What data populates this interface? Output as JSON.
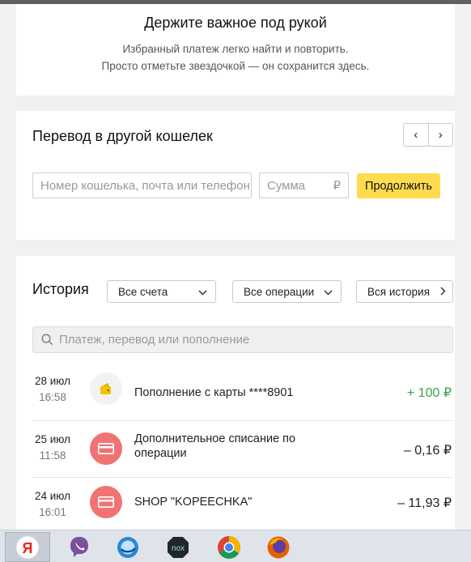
{
  "favorites": {
    "title": "Держите важное под рукой",
    "line1": "Избранный платеж легко найти и повторить.",
    "line2": "Просто отметьте звездочкой — он сохранится здесь."
  },
  "transfer": {
    "title": "Перевод в другой кошелек",
    "prev_label": "‹",
    "next_label": "›",
    "wallet_placeholder": "Номер кошелька, почта или телефон",
    "sum_placeholder": "Сумма",
    "currency": "₽",
    "continue_label": "Продолжить"
  },
  "history": {
    "title": "История",
    "accounts_filter": "Все счета",
    "operations_filter": "Все операции",
    "all_history_label": "Вся история",
    "search_placeholder": "Платеж, перевод или пополнение",
    "items": [
      {
        "date": "28 июл",
        "time": "16:58",
        "description": "Пополнение с карты ****8901",
        "amount": "+ 100 ₽",
        "icon": "wallet-icon"
      },
      {
        "date": "25 июл",
        "time": "11:58",
        "description": "Дополнительное списание по операции",
        "amount": "– 0,16 ₽",
        "icon": "card-icon"
      },
      {
        "date": "24 июл",
        "time": "16:01",
        "description": "SHOP \"KOPEECHKA\"",
        "amount": "– 11,93 ₽",
        "icon": "card-icon"
      }
    ]
  },
  "colors": {
    "accent_yellow": "#ffdb4d",
    "income_green": "#3aa24a",
    "card_red": "#f07373"
  },
  "taskbar": {
    "apps": [
      "yandex-browser-icon",
      "viber-icon",
      "cyberduck-icon",
      "nox-icon",
      "chrome-icon",
      "firefox-icon"
    ],
    "nox_label": "nox"
  }
}
